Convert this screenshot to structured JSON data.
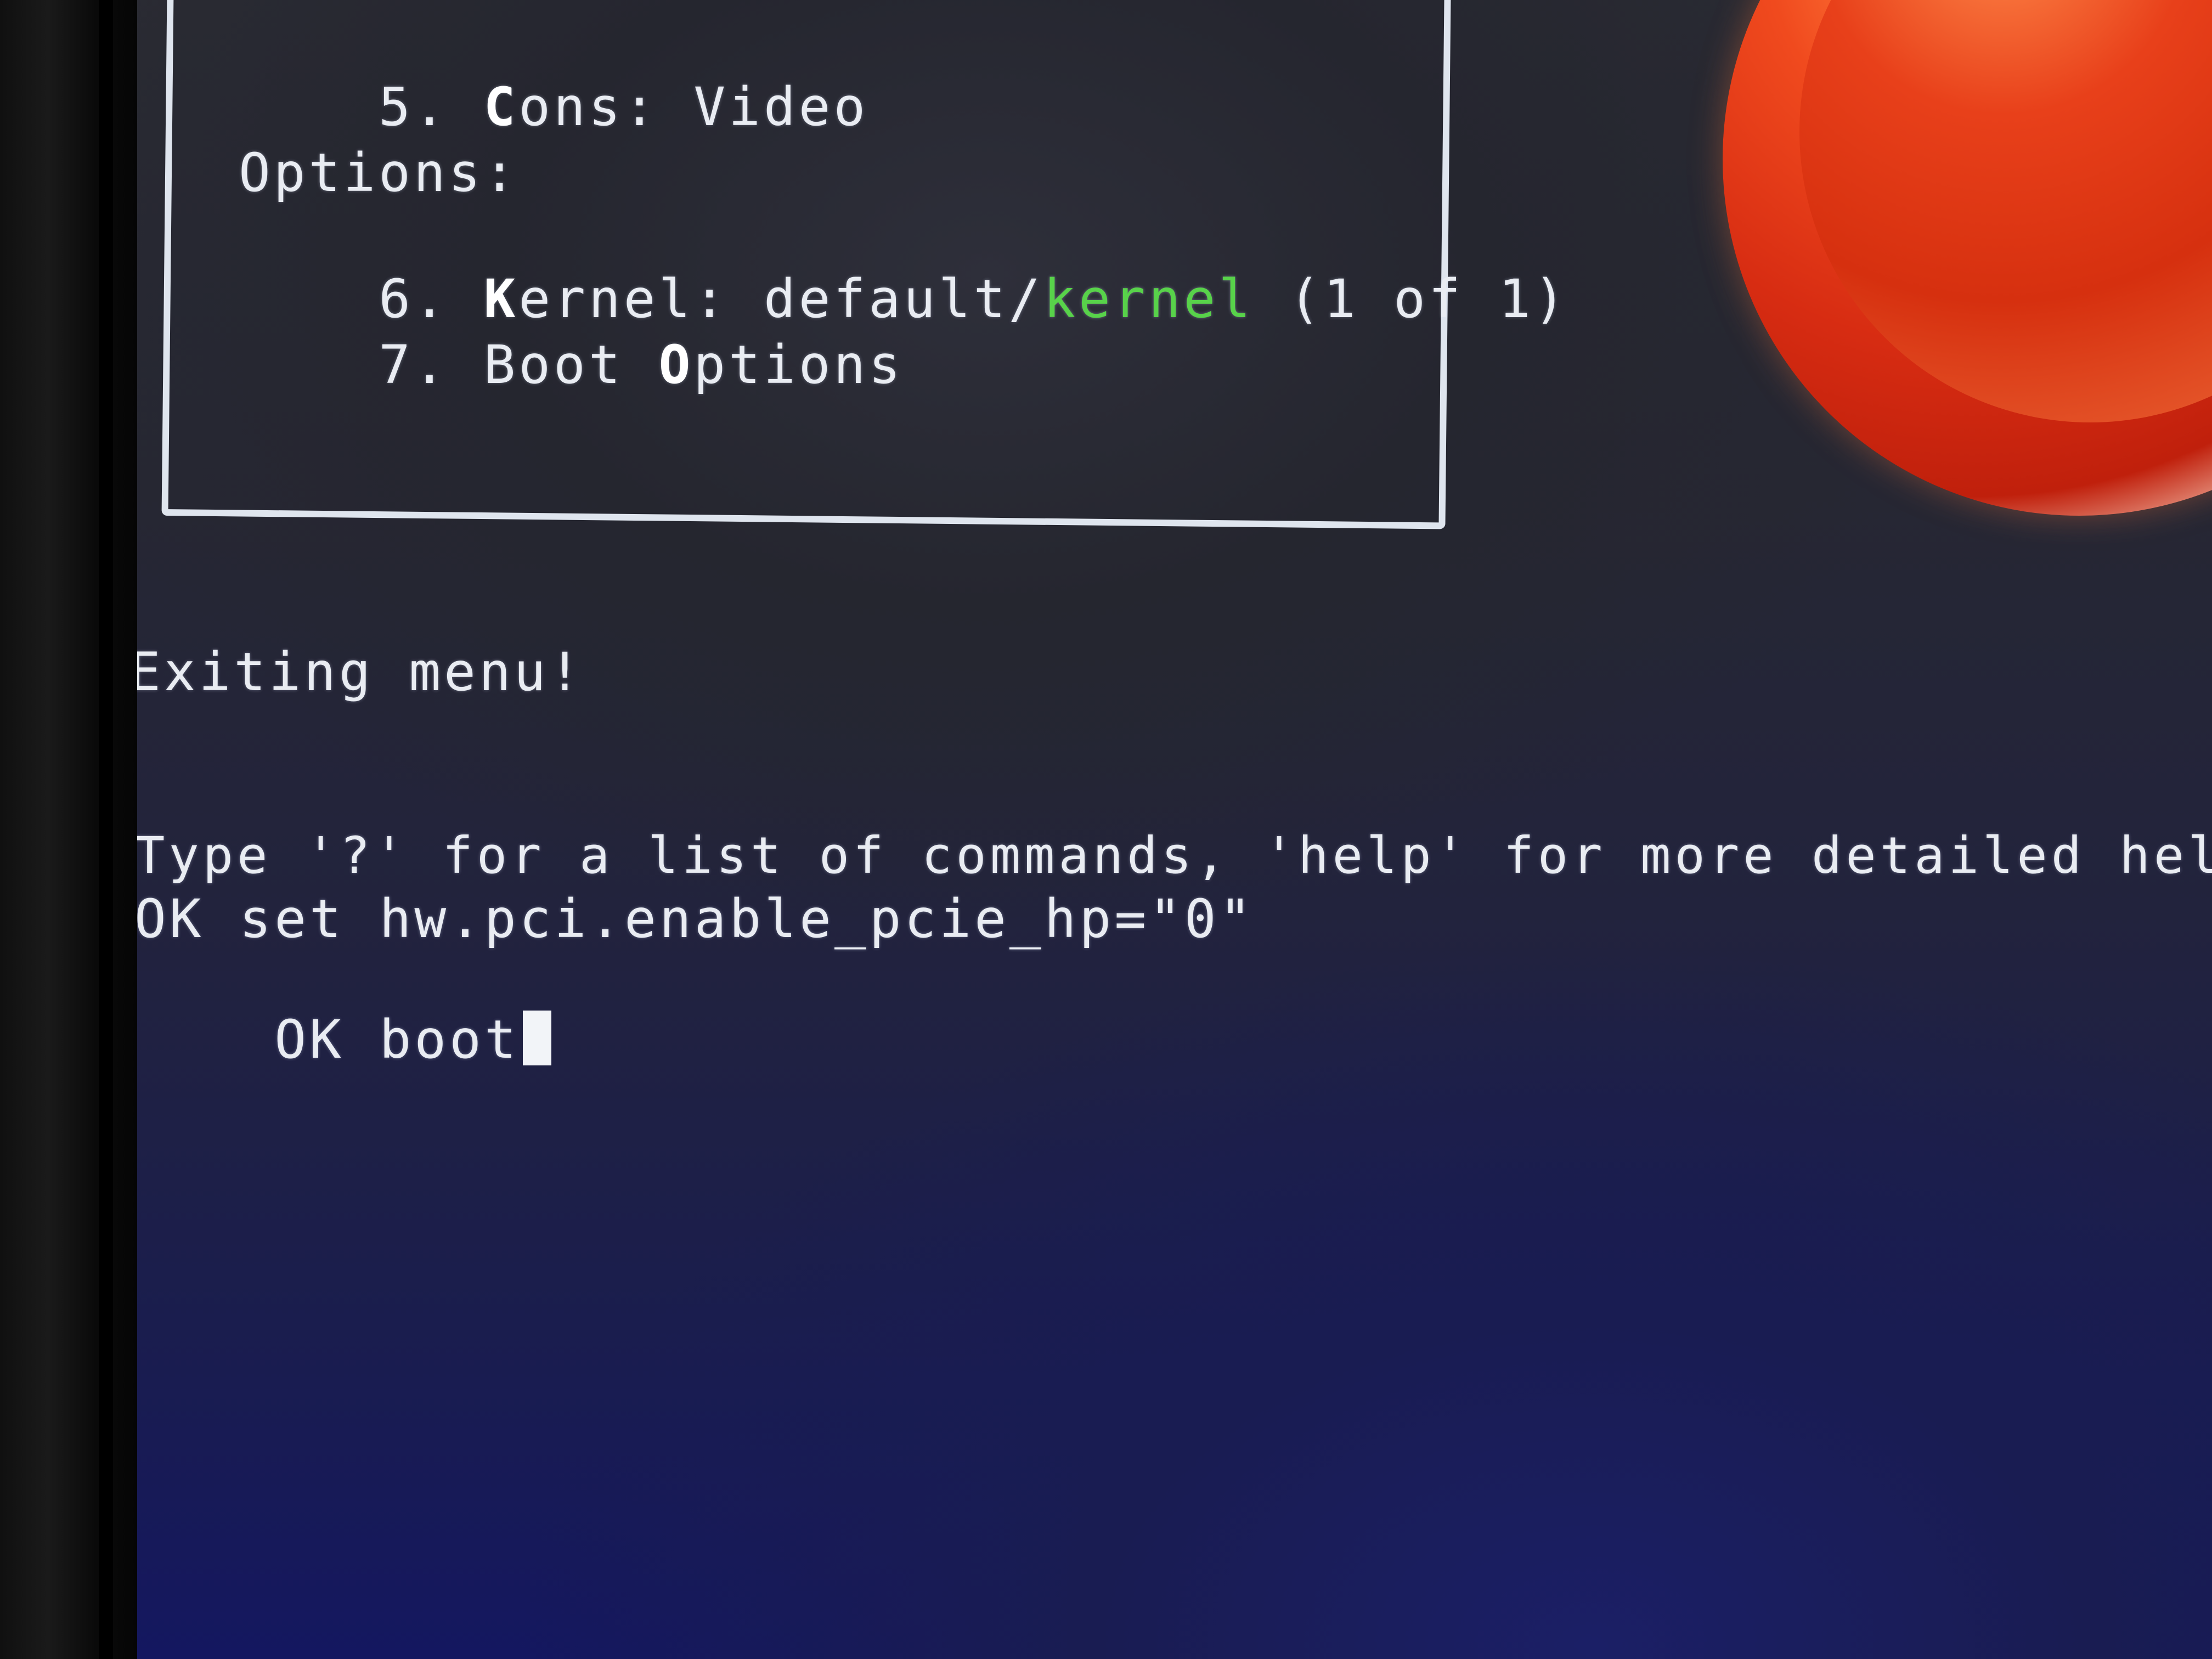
{
  "menu": {
    "item5": {
      "number": "5.",
      "hotkey": "C",
      "rest": "ons:",
      "value": "Video"
    },
    "options_heading": "Options:",
    "item6": {
      "number": "6.",
      "hotkey": "K",
      "rest": "ernel:",
      "path_prefix": "default/",
      "path_highlight": "kernel",
      "suffix": "(1 of 1)"
    },
    "item7": {
      "number": "7.",
      "prefix": "Boot",
      "hotkey": "O",
      "rest": "ptions"
    }
  },
  "console": {
    "exit_message": "Exiting menu!",
    "help_hint": "Type '?' for a list of commands, 'help' for more detailed help.",
    "command1": "OK set hw.pci.enable_pcie_hp=\"0\"",
    "command2": "OK boot"
  },
  "colors": {
    "text": "#e9ecf2",
    "highlight_green": "#58d24a",
    "logo_red": "#d72c12"
  },
  "icons": {
    "logo": "freebsd-beastie-orb-icon"
  }
}
